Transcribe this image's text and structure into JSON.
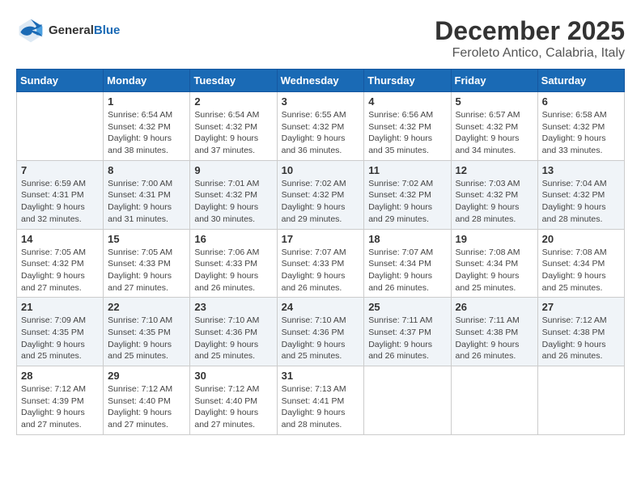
{
  "header": {
    "logo_general": "General",
    "logo_blue": "Blue",
    "month": "December 2025",
    "location": "Feroleto Antico, Calabria, Italy"
  },
  "weekdays": [
    "Sunday",
    "Monday",
    "Tuesday",
    "Wednesday",
    "Thursday",
    "Friday",
    "Saturday"
  ],
  "weeks": [
    [
      {
        "day": "",
        "info": ""
      },
      {
        "day": "1",
        "info": "Sunrise: 6:54 AM\nSunset: 4:32 PM\nDaylight: 9 hours\nand 38 minutes."
      },
      {
        "day": "2",
        "info": "Sunrise: 6:54 AM\nSunset: 4:32 PM\nDaylight: 9 hours\nand 37 minutes."
      },
      {
        "day": "3",
        "info": "Sunrise: 6:55 AM\nSunset: 4:32 PM\nDaylight: 9 hours\nand 36 minutes."
      },
      {
        "day": "4",
        "info": "Sunrise: 6:56 AM\nSunset: 4:32 PM\nDaylight: 9 hours\nand 35 minutes."
      },
      {
        "day": "5",
        "info": "Sunrise: 6:57 AM\nSunset: 4:32 PM\nDaylight: 9 hours\nand 34 minutes."
      },
      {
        "day": "6",
        "info": "Sunrise: 6:58 AM\nSunset: 4:32 PM\nDaylight: 9 hours\nand 33 minutes."
      }
    ],
    [
      {
        "day": "7",
        "info": "Sunrise: 6:59 AM\nSunset: 4:31 PM\nDaylight: 9 hours\nand 32 minutes."
      },
      {
        "day": "8",
        "info": "Sunrise: 7:00 AM\nSunset: 4:31 PM\nDaylight: 9 hours\nand 31 minutes."
      },
      {
        "day": "9",
        "info": "Sunrise: 7:01 AM\nSunset: 4:32 PM\nDaylight: 9 hours\nand 30 minutes."
      },
      {
        "day": "10",
        "info": "Sunrise: 7:02 AM\nSunset: 4:32 PM\nDaylight: 9 hours\nand 29 minutes."
      },
      {
        "day": "11",
        "info": "Sunrise: 7:02 AM\nSunset: 4:32 PM\nDaylight: 9 hours\nand 29 minutes."
      },
      {
        "day": "12",
        "info": "Sunrise: 7:03 AM\nSunset: 4:32 PM\nDaylight: 9 hours\nand 28 minutes."
      },
      {
        "day": "13",
        "info": "Sunrise: 7:04 AM\nSunset: 4:32 PM\nDaylight: 9 hours\nand 28 minutes."
      }
    ],
    [
      {
        "day": "14",
        "info": "Sunrise: 7:05 AM\nSunset: 4:32 PM\nDaylight: 9 hours\nand 27 minutes."
      },
      {
        "day": "15",
        "info": "Sunrise: 7:05 AM\nSunset: 4:33 PM\nDaylight: 9 hours\nand 27 minutes."
      },
      {
        "day": "16",
        "info": "Sunrise: 7:06 AM\nSunset: 4:33 PM\nDaylight: 9 hours\nand 26 minutes."
      },
      {
        "day": "17",
        "info": "Sunrise: 7:07 AM\nSunset: 4:33 PM\nDaylight: 9 hours\nand 26 minutes."
      },
      {
        "day": "18",
        "info": "Sunrise: 7:07 AM\nSunset: 4:34 PM\nDaylight: 9 hours\nand 26 minutes."
      },
      {
        "day": "19",
        "info": "Sunrise: 7:08 AM\nSunset: 4:34 PM\nDaylight: 9 hours\nand 25 minutes."
      },
      {
        "day": "20",
        "info": "Sunrise: 7:08 AM\nSunset: 4:34 PM\nDaylight: 9 hours\nand 25 minutes."
      }
    ],
    [
      {
        "day": "21",
        "info": "Sunrise: 7:09 AM\nSunset: 4:35 PM\nDaylight: 9 hours\nand 25 minutes."
      },
      {
        "day": "22",
        "info": "Sunrise: 7:10 AM\nSunset: 4:35 PM\nDaylight: 9 hours\nand 25 minutes."
      },
      {
        "day": "23",
        "info": "Sunrise: 7:10 AM\nSunset: 4:36 PM\nDaylight: 9 hours\nand 25 minutes."
      },
      {
        "day": "24",
        "info": "Sunrise: 7:10 AM\nSunset: 4:36 PM\nDaylight: 9 hours\nand 25 minutes."
      },
      {
        "day": "25",
        "info": "Sunrise: 7:11 AM\nSunset: 4:37 PM\nDaylight: 9 hours\nand 26 minutes."
      },
      {
        "day": "26",
        "info": "Sunrise: 7:11 AM\nSunset: 4:38 PM\nDaylight: 9 hours\nand 26 minutes."
      },
      {
        "day": "27",
        "info": "Sunrise: 7:12 AM\nSunset: 4:38 PM\nDaylight: 9 hours\nand 26 minutes."
      }
    ],
    [
      {
        "day": "28",
        "info": "Sunrise: 7:12 AM\nSunset: 4:39 PM\nDaylight: 9 hours\nand 27 minutes."
      },
      {
        "day": "29",
        "info": "Sunrise: 7:12 AM\nSunset: 4:40 PM\nDaylight: 9 hours\nand 27 minutes."
      },
      {
        "day": "30",
        "info": "Sunrise: 7:12 AM\nSunset: 4:40 PM\nDaylight: 9 hours\nand 27 minutes."
      },
      {
        "day": "31",
        "info": "Sunrise: 7:13 AM\nSunset: 4:41 PM\nDaylight: 9 hours\nand 28 minutes."
      },
      {
        "day": "",
        "info": ""
      },
      {
        "day": "",
        "info": ""
      },
      {
        "day": "",
        "info": ""
      }
    ]
  ]
}
